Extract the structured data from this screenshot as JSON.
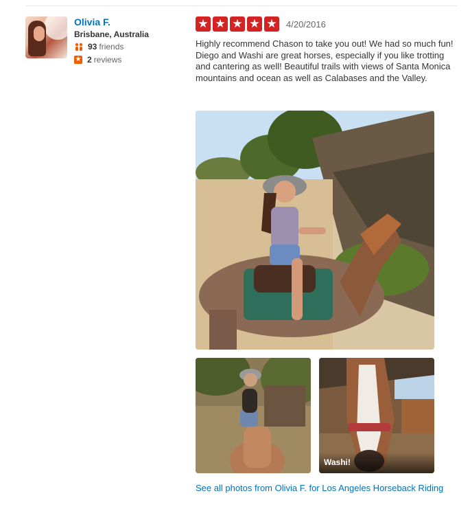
{
  "user": {
    "name": "Olivia F.",
    "location": "Brisbane, Australia",
    "friends_count": "93",
    "friends_label": "friends",
    "reviews_count": "2",
    "reviews_label": "reviews",
    "avatar_icon": "avatar-photo"
  },
  "review": {
    "rating": 5,
    "rating_max": 5,
    "star_color": "#d32323",
    "date": "4/20/2016",
    "text": "Highly recommend Chason to take you out! We had so much fun! Diego and Washi are great horses, especially if you like trotting and cantering as well! Beautiful trails with views of Santa Monica mountains and ocean as well as Calabases and the Valley."
  },
  "photos": [
    {
      "caption": ""
    },
    {
      "caption": ""
    },
    {
      "caption": "Washi!"
    }
  ],
  "see_all_link": "See all photos from Olivia F. for Los Angeles Horseback Riding",
  "colors": {
    "link": "#0073bb",
    "accent_orange": "#f15c00"
  }
}
